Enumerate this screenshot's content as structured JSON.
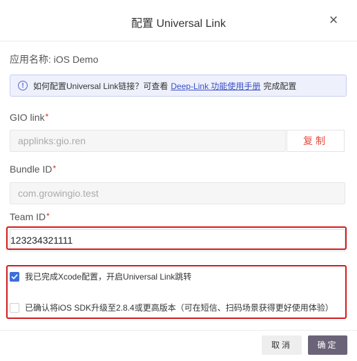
{
  "dialog": {
    "title": "配置 Universal Link",
    "close_symbol": "×",
    "app_name": "应用名称: iOS Demo"
  },
  "info": {
    "icon": "!",
    "text_before": "如何配置Universal Link链接？可查看",
    "link": "Deep-Link 功能使用手册",
    "text_after": "完成配置"
  },
  "fields": {
    "gio_link": {
      "label": "GIO link",
      "value": "applinks:gio.ren",
      "copy_label": "复制"
    },
    "bundle_id": {
      "label": "Bundle ID",
      "value": "com.growingio.test"
    },
    "team_id": {
      "label": "Team ID",
      "value": "123234321111"
    },
    "required_mark": "*"
  },
  "checks": {
    "xcode": {
      "label": "我已完成Xcode配置，开启Universal Link跳转",
      "checked": true
    },
    "sdk": {
      "label": "已确认将iOS SDK升级至2.8.4或更高版本（可在短信、扫码场景获得更好使用体验）",
      "checked": false
    },
    "check_mark": "✓"
  },
  "footer": {
    "cancel": "取消",
    "confirm": "确定"
  },
  "colors": {
    "accent": "#3c6fd9",
    "highlight_border": "#d21b1b",
    "confirm_bg": "#6b6478",
    "link": "#3a4fc4"
  }
}
